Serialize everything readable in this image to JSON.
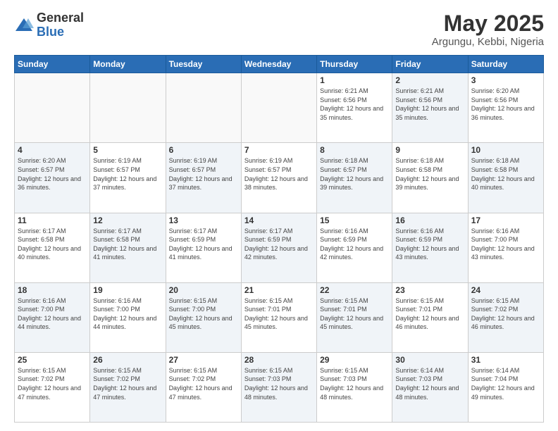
{
  "logo": {
    "general": "General",
    "blue": "Blue"
  },
  "header": {
    "month": "May 2025",
    "location": "Argungu, Kebbi, Nigeria"
  },
  "weekdays": [
    "Sunday",
    "Monday",
    "Tuesday",
    "Wednesday",
    "Thursday",
    "Friday",
    "Saturday"
  ],
  "weeks": [
    [
      {
        "day": "",
        "empty": true
      },
      {
        "day": "",
        "empty": true
      },
      {
        "day": "",
        "empty": true
      },
      {
        "day": "",
        "empty": true
      },
      {
        "day": "1",
        "sunrise": "6:21 AM",
        "sunset": "6:56 PM",
        "daylight": "12 hours and 35 minutes."
      },
      {
        "day": "2",
        "sunrise": "6:21 AM",
        "sunset": "6:56 PM",
        "daylight": "12 hours and 35 minutes.",
        "shaded": true
      },
      {
        "day": "3",
        "sunrise": "6:20 AM",
        "sunset": "6:56 PM",
        "daylight": "12 hours and 36 minutes."
      }
    ],
    [
      {
        "day": "4",
        "sunrise": "6:20 AM",
        "sunset": "6:57 PM",
        "daylight": "12 hours and 36 minutes.",
        "shaded": true
      },
      {
        "day": "5",
        "sunrise": "6:19 AM",
        "sunset": "6:57 PM",
        "daylight": "12 hours and 37 minutes."
      },
      {
        "day": "6",
        "sunrise": "6:19 AM",
        "sunset": "6:57 PM",
        "daylight": "12 hours and 37 minutes.",
        "shaded": true
      },
      {
        "day": "7",
        "sunrise": "6:19 AM",
        "sunset": "6:57 PM",
        "daylight": "12 hours and 38 minutes."
      },
      {
        "day": "8",
        "sunrise": "6:18 AM",
        "sunset": "6:57 PM",
        "daylight": "12 hours and 39 minutes.",
        "shaded": true
      },
      {
        "day": "9",
        "sunrise": "6:18 AM",
        "sunset": "6:58 PM",
        "daylight": "12 hours and 39 minutes."
      },
      {
        "day": "10",
        "sunrise": "6:18 AM",
        "sunset": "6:58 PM",
        "daylight": "12 hours and 40 minutes.",
        "shaded": true
      }
    ],
    [
      {
        "day": "11",
        "sunrise": "6:17 AM",
        "sunset": "6:58 PM",
        "daylight": "12 hours and 40 minutes."
      },
      {
        "day": "12",
        "sunrise": "6:17 AM",
        "sunset": "6:58 PM",
        "daylight": "12 hours and 41 minutes.",
        "shaded": true
      },
      {
        "day": "13",
        "sunrise": "6:17 AM",
        "sunset": "6:59 PM",
        "daylight": "12 hours and 41 minutes."
      },
      {
        "day": "14",
        "sunrise": "6:17 AM",
        "sunset": "6:59 PM",
        "daylight": "12 hours and 42 minutes.",
        "shaded": true
      },
      {
        "day": "15",
        "sunrise": "6:16 AM",
        "sunset": "6:59 PM",
        "daylight": "12 hours and 42 minutes."
      },
      {
        "day": "16",
        "sunrise": "6:16 AM",
        "sunset": "6:59 PM",
        "daylight": "12 hours and 43 minutes.",
        "shaded": true
      },
      {
        "day": "17",
        "sunrise": "6:16 AM",
        "sunset": "7:00 PM",
        "daylight": "12 hours and 43 minutes."
      }
    ],
    [
      {
        "day": "18",
        "sunrise": "6:16 AM",
        "sunset": "7:00 PM",
        "daylight": "12 hours and 44 minutes.",
        "shaded": true
      },
      {
        "day": "19",
        "sunrise": "6:16 AM",
        "sunset": "7:00 PM",
        "daylight": "12 hours and 44 minutes."
      },
      {
        "day": "20",
        "sunrise": "6:15 AM",
        "sunset": "7:00 PM",
        "daylight": "12 hours and 45 minutes.",
        "shaded": true
      },
      {
        "day": "21",
        "sunrise": "6:15 AM",
        "sunset": "7:01 PM",
        "daylight": "12 hours and 45 minutes."
      },
      {
        "day": "22",
        "sunrise": "6:15 AM",
        "sunset": "7:01 PM",
        "daylight": "12 hours and 45 minutes.",
        "shaded": true
      },
      {
        "day": "23",
        "sunrise": "6:15 AM",
        "sunset": "7:01 PM",
        "daylight": "12 hours and 46 minutes."
      },
      {
        "day": "24",
        "sunrise": "6:15 AM",
        "sunset": "7:02 PM",
        "daylight": "12 hours and 46 minutes.",
        "shaded": true
      }
    ],
    [
      {
        "day": "25",
        "sunrise": "6:15 AM",
        "sunset": "7:02 PM",
        "daylight": "12 hours and 47 minutes."
      },
      {
        "day": "26",
        "sunrise": "6:15 AM",
        "sunset": "7:02 PM",
        "daylight": "12 hours and 47 minutes.",
        "shaded": true
      },
      {
        "day": "27",
        "sunrise": "6:15 AM",
        "sunset": "7:02 PM",
        "daylight": "12 hours and 47 minutes."
      },
      {
        "day": "28",
        "sunrise": "6:15 AM",
        "sunset": "7:03 PM",
        "daylight": "12 hours and 48 minutes.",
        "shaded": true
      },
      {
        "day": "29",
        "sunrise": "6:15 AM",
        "sunset": "7:03 PM",
        "daylight": "12 hours and 48 minutes."
      },
      {
        "day": "30",
        "sunrise": "6:14 AM",
        "sunset": "7:03 PM",
        "daylight": "12 hours and 48 minutes.",
        "shaded": true
      },
      {
        "day": "31",
        "sunrise": "6:14 AM",
        "sunset": "7:04 PM",
        "daylight": "12 hours and 49 minutes."
      }
    ]
  ],
  "labels": {
    "sunrise": "Sunrise:",
    "sunset": "Sunset:",
    "daylight": "Daylight:"
  }
}
